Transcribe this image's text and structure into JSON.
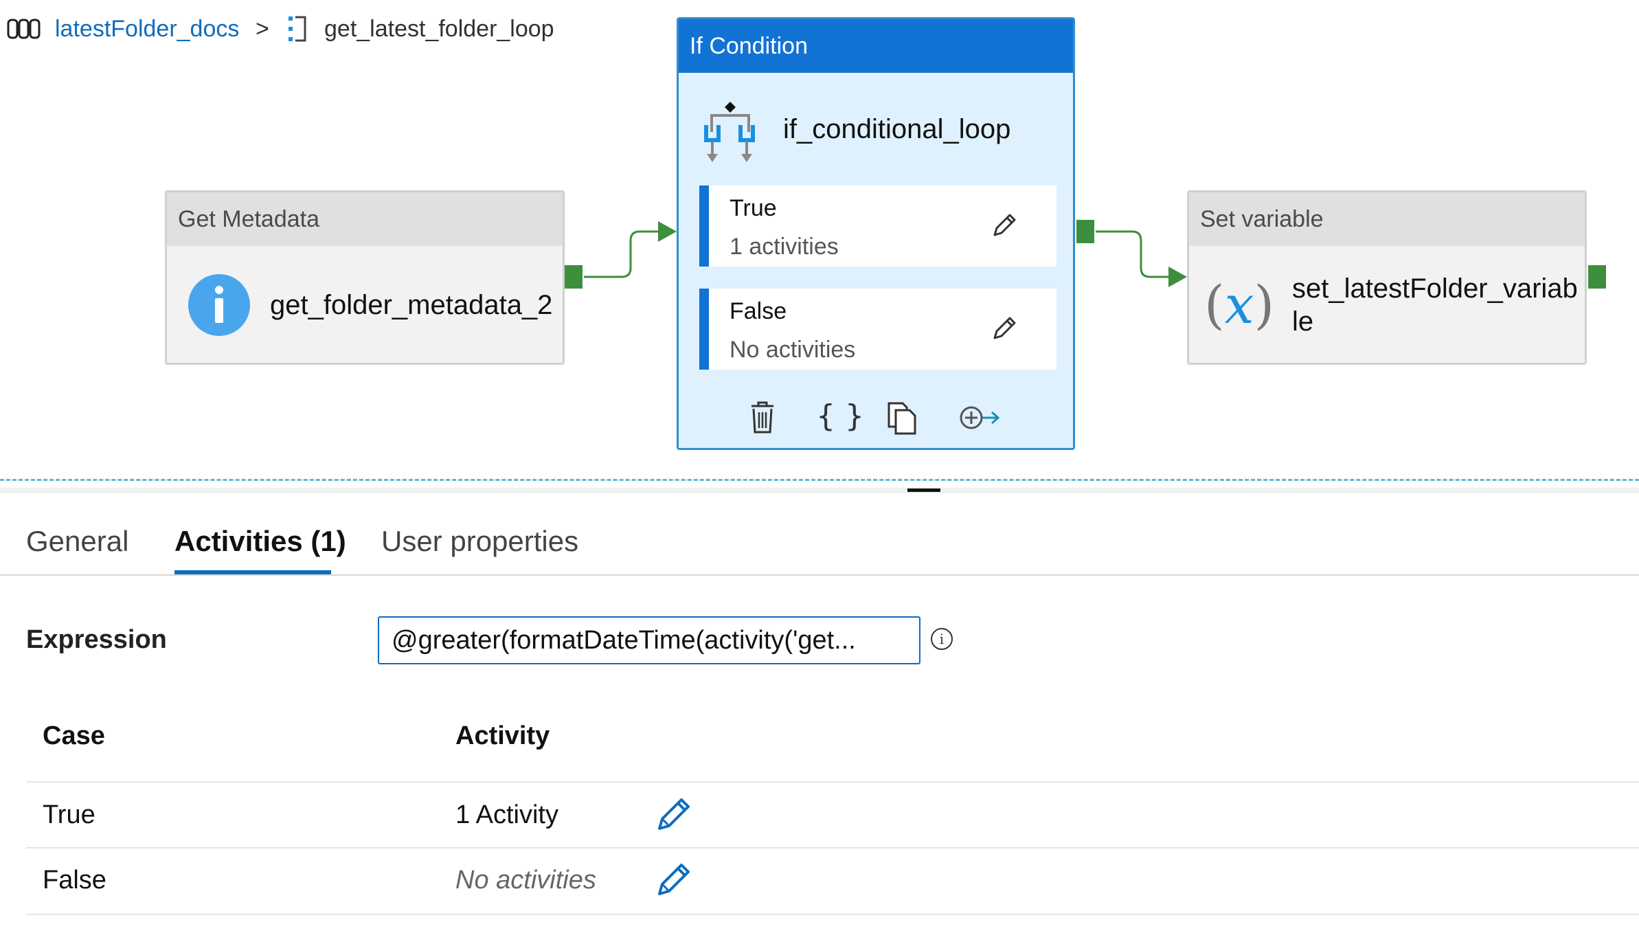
{
  "breadcrumb": {
    "pipeline_icon": "pipeline-icon",
    "pipeline": "latestFolder_docs",
    "separator": ">",
    "activity_icon": "activity-bracket-icon",
    "activity": "get_latest_folder_loop"
  },
  "canvas": {
    "get_metadata": {
      "type": "Get Metadata",
      "name": "get_folder_metadata_2",
      "icon": "info-icon"
    },
    "if_condition": {
      "type": "If Condition",
      "name": "if_conditional_loop",
      "icon": "branch-icon",
      "cases": [
        {
          "title": "True",
          "subtitle": "1 activities"
        },
        {
          "title": "False",
          "subtitle": "No activities"
        }
      ],
      "toolbar_icons": [
        "delete-icon",
        "code-icon",
        "copy-icon",
        "add-output-icon"
      ]
    },
    "set_variable": {
      "type": "Set variable",
      "name_line1": "set_latestFolder_variab",
      "name_line2": "le",
      "icon": "variable-icon"
    }
  },
  "tabs": [
    {
      "label": "General",
      "active": false
    },
    {
      "label": "Activities (1)",
      "active": true
    },
    {
      "label": "User properties",
      "active": false
    }
  ],
  "expression": {
    "label": "Expression",
    "value": "@greater(formatDateTime(activity('get..."
  },
  "table": {
    "headers": [
      "Case",
      "Activity"
    ],
    "rows": [
      {
        "case": "True",
        "activity": "1 Activity",
        "empty": false
      },
      {
        "case": "False",
        "activity": "No activities",
        "empty": true
      }
    ]
  },
  "colors": {
    "accent": "#0f6cbd",
    "if_header": "#1173d4",
    "if_body": "#dff1fe",
    "connector": "#3d8f3d"
  }
}
